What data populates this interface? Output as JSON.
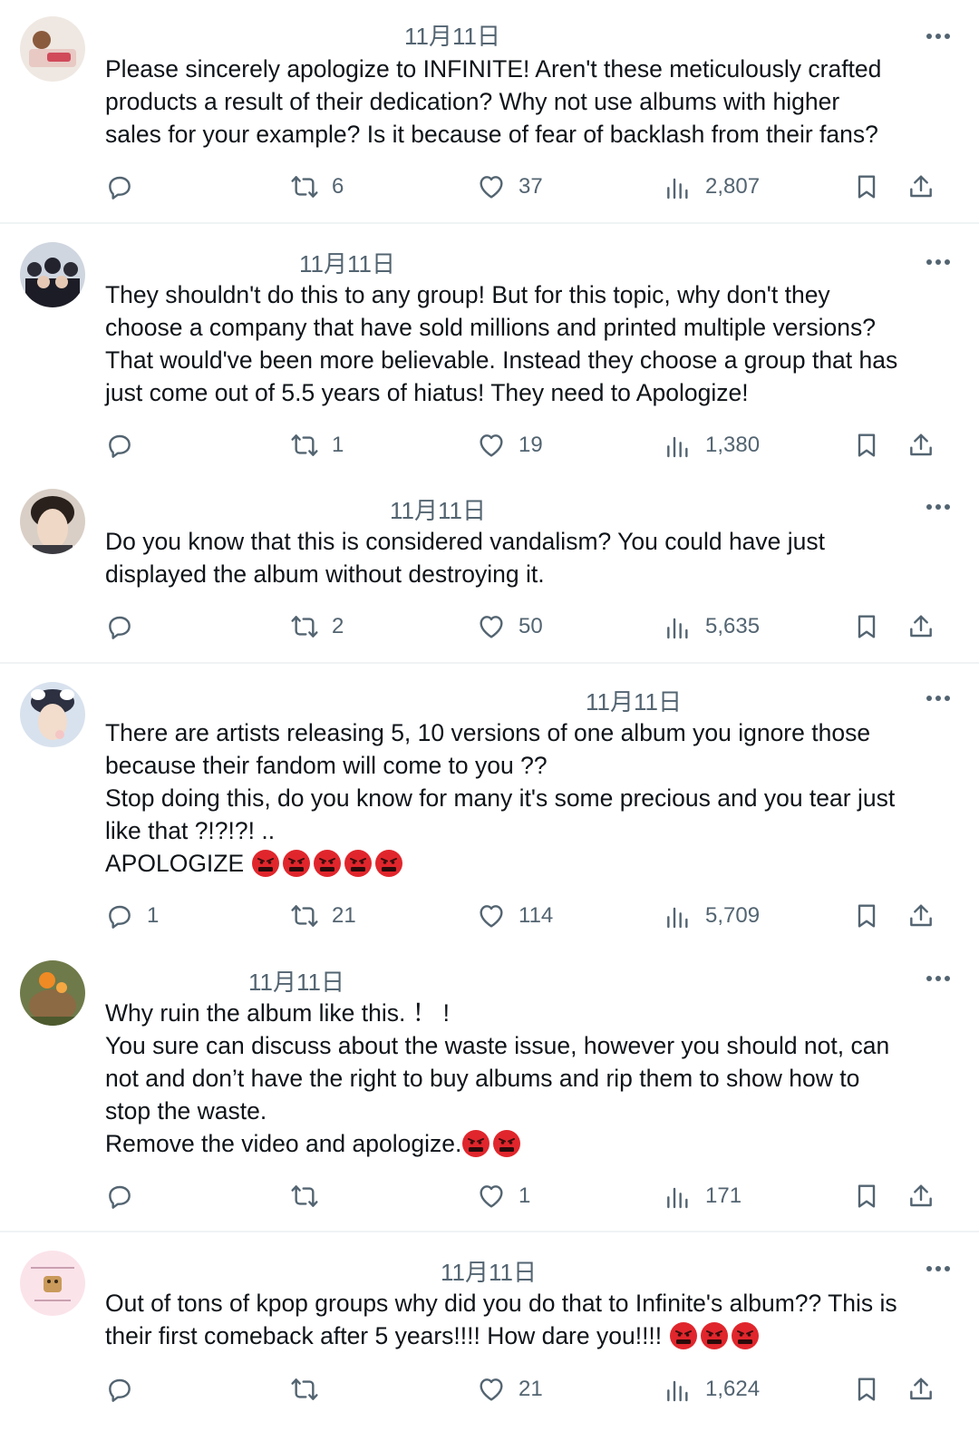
{
  "posts": [
    {
      "date": "11月11日",
      "lines": [
        "Please sincerely apologize to INFINITE! Aren't these meticulously crafted",
        "products a result of their dedication? Why not use albums with higher",
        "sales for your example? Is it because of fear of backlash from their fans?"
      ],
      "replies": "",
      "reposts": "6",
      "likes": "37",
      "views": "2,807"
    },
    {
      "date": "11月11日",
      "lines": [
        "They shouldn't do this to any group! But for this topic, why don't they",
        "choose a company that have sold millions and printed multiple versions?",
        "That would've been more believable. Instead they choose a group that has",
        "just come out of 5.5 years of hiatus! They need to Apologize!"
      ],
      "replies": "",
      "reposts": "1",
      "likes": "19",
      "views": "1,380"
    },
    {
      "date": "11月11日",
      "lines": [
        "Do you know that this is considered vandalism? You could have just",
        "displayed the album without destroying it."
      ],
      "replies": "",
      "reposts": "2",
      "likes": "50",
      "views": "5,635"
    },
    {
      "date": "11月11日",
      "lines": [
        "There are artists releasing 5, 10 versions of one album you ignore those",
        "because their fandom will come to you ??",
        "Stop doing this, do you know for many it's some precious and you tear just",
        "like that ?!?!?! ..",
        "APOLOGIZE"
      ],
      "emoji_count": 5,
      "replies": "1",
      "reposts": "21",
      "likes": "114",
      "views": "5,709"
    },
    {
      "date": "11月11日",
      "lines": [
        "Why ruin the album like this. ！ !",
        "You sure can discuss about the waste issue, however you should not, can",
        "not and don’t have the right to buy albums and rip them to show how to",
        "stop the waste.",
        "Remove the video and apologize."
      ],
      "emoji_count": 2,
      "replies": "",
      "reposts": "",
      "likes": "1",
      "views": "171"
    },
    {
      "date": "11月11日",
      "lines": [
        "Out of tons of kpop groups why did you do that to Infinite's album?? This is",
        "their first comeback after 5 years!!!! How dare you!!!!"
      ],
      "emoji_count": 3,
      "replies": "",
      "reposts": "",
      "likes": "21",
      "views": "1,624"
    }
  ],
  "icons": {
    "reply": "reply-icon",
    "repost": "repost-icon",
    "like": "heart-icon",
    "views": "views-icon",
    "bookmark": "bookmark-icon",
    "share": "share-icon",
    "more": "more-icon",
    "emoji": "pouting-face-with-symbols-emoji"
  },
  "colors": {
    "text": "#0f1419",
    "secondary": "#536471",
    "divider": "#eff3f4",
    "emoji": "#e0262c"
  }
}
